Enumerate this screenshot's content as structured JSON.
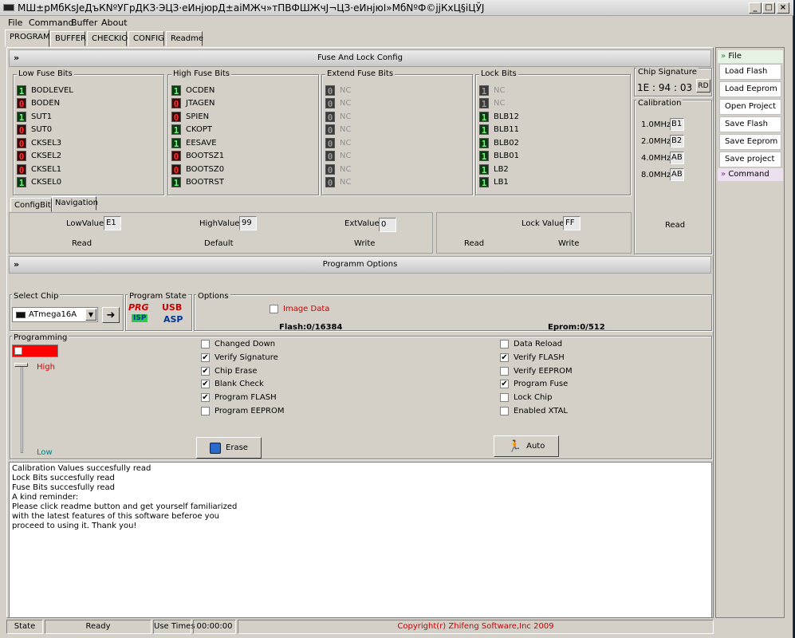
{
  "window": {
    "title": "МШ±рМбКsЈеДъКNºУГрДКЗ·ЭЦЗ·еИнјюрД±аіМЖч»тПВФШЖчЈ¬ЦЗ·еИнјюІ»МбNºФ©jjКхЦ§iЦЎЈ",
    "buttons": [
      "_",
      "□",
      "×"
    ]
  },
  "menu": [
    "File",
    "Command",
    "Buffer",
    "About"
  ],
  "tabs": [
    "PROGRAM",
    "BUFFER",
    "CHECKIO",
    "CONFIG",
    "Readme"
  ],
  "fuse_section": {
    "header": "Fuse And Lock Config",
    "low": {
      "title": "Low Fuse Bits",
      "bits": [
        {
          "v": "1",
          "s": "on",
          "n": "BODLEVEL"
        },
        {
          "v": "0",
          "s": "off",
          "n": "BODEN"
        },
        {
          "v": "1",
          "s": "on",
          "n": "SUT1"
        },
        {
          "v": "0",
          "s": "off",
          "n": "SUT0"
        },
        {
          "v": "0",
          "s": "off",
          "n": "CKSEL3"
        },
        {
          "v": "0",
          "s": "off",
          "n": "CKSEL2"
        },
        {
          "v": "0",
          "s": "off",
          "n": "CKSEL1"
        },
        {
          "v": "1",
          "s": "on",
          "n": "CKSEL0"
        }
      ]
    },
    "high": {
      "title": "High Fuse Bits",
      "bits": [
        {
          "v": "1",
          "s": "on",
          "n": "OCDEN"
        },
        {
          "v": "0",
          "s": "off",
          "n": "JTAGEN"
        },
        {
          "v": "0",
          "s": "off",
          "n": "SPIEN"
        },
        {
          "v": "1",
          "s": "on",
          "n": "CKOPT"
        },
        {
          "v": "1",
          "s": "on",
          "n": "EESAVE"
        },
        {
          "v": "0",
          "s": "off",
          "n": "BOOTSZ1"
        },
        {
          "v": "0",
          "s": "off",
          "n": "BOOTSZ0"
        },
        {
          "v": "1",
          "s": "on",
          "n": "BOOTRST"
        }
      ]
    },
    "extend": {
      "title": "Extend Fuse Bits",
      "bits": [
        {
          "v": "0",
          "s": "na",
          "n": "NC"
        },
        {
          "v": "0",
          "s": "na",
          "n": "NC"
        },
        {
          "v": "0",
          "s": "na",
          "n": "NC"
        },
        {
          "v": "0",
          "s": "na",
          "n": "NC"
        },
        {
          "v": "0",
          "s": "na",
          "n": "NC"
        },
        {
          "v": "0",
          "s": "na",
          "n": "NC"
        },
        {
          "v": "0",
          "s": "na",
          "n": "NC"
        },
        {
          "v": "0",
          "s": "na",
          "n": "NC"
        }
      ]
    },
    "lock": {
      "title": "Lock Bits",
      "bits": [
        {
          "v": "1",
          "s": "na",
          "n": "NC"
        },
        {
          "v": "1",
          "s": "na",
          "n": "NC"
        },
        {
          "v": "1",
          "s": "on",
          "n": "BLB12"
        },
        {
          "v": "1",
          "s": "on",
          "n": "BLB11"
        },
        {
          "v": "1",
          "s": "on",
          "n": "BLB02"
        },
        {
          "v": "1",
          "s": "on",
          "n": "BLB01"
        },
        {
          "v": "1",
          "s": "on",
          "n": "LB2"
        },
        {
          "v": "1",
          "s": "on",
          "n": "LB1"
        }
      ]
    },
    "subtabs": [
      "ConfigBit",
      "Navigation"
    ],
    "low_value_label": "LowValue",
    "low_value": "E1",
    "high_value_label": "HighValue",
    "high_value": "99",
    "ext_value_label": "ExtValue",
    "ext_value": "0",
    "lock_value_label": "Lock Value",
    "lock_value": "FF",
    "read": "Read",
    "default": "Default",
    "write": "Write",
    "lock_read": "Read",
    "lock_write": "Write"
  },
  "chip_signature": {
    "title": "Chip Signature",
    "value": "1E : 94 : 03",
    "rd": "RD"
  },
  "calibration": {
    "title": "Calibration",
    "rows": [
      {
        "f": "1.0MHz",
        "v": "B1"
      },
      {
        "f": "2.0MHz",
        "v": "B2"
      },
      {
        "f": "4.0MHz",
        "v": "AB"
      },
      {
        "f": "8.0MHz",
        "v": "AB"
      }
    ],
    "read": "Read"
  },
  "prog_options": {
    "header": "Programm Options",
    "select_chip": {
      "title": "Select Chip",
      "value": "ATmega16A"
    },
    "program_state": {
      "title": "Program State",
      "prg": "PRG",
      "isp": "ISP",
      "usb": "USB",
      "asp": "ASP"
    },
    "options": {
      "title": "Options",
      "image_data": "Image Data",
      "flash": "Flash:0/16384",
      "eprom": "Eprom:0/512"
    },
    "programming_title": "Programming",
    "high": "High",
    "low": "Low",
    "checks_mid": [
      {
        "l": "Changed Down",
        "c": false
      },
      {
        "l": "Verify Signature",
        "c": true
      },
      {
        "l": "Chip Erase",
        "c": true
      },
      {
        "l": "Blank Check",
        "c": true
      },
      {
        "l": "Program FLASH",
        "c": true
      },
      {
        "l": "Program EEPROM",
        "c": false
      }
    ],
    "checks_right": [
      {
        "l": "Data Reload",
        "c": false
      },
      {
        "l": "Verify FLASH",
        "c": true
      },
      {
        "l": "Verify EEPROM",
        "c": false
      },
      {
        "l": "Program Fuse",
        "c": true
      },
      {
        "l": "Lock Chip",
        "c": false
      },
      {
        "l": "Enabled XTAL",
        "c": false
      }
    ],
    "erase": "Erase",
    "auto": "Auto"
  },
  "log": "Calibration Values succesfully read\nLock Bits succesfully read\nFuse Bits succesfully read\nA kind reminder:\nPlease click readme button and get yourself familiarized\nwith the latest features of this software beferoe you\nproceed to using it. Thank you!",
  "status": {
    "state_label": "State",
    "state": "Ready",
    "use_times_label": "Use Times",
    "use_times": "00:00:00",
    "copyright": "Copyright(r) Zhifeng Software,Inc 2009"
  },
  "side": {
    "file_header": "File",
    "buttons": [
      "Load Flash",
      "Load Eeprom",
      "Open Project",
      "Save Flash",
      "Save Eeprom",
      "Save project"
    ],
    "command_header": "Command"
  },
  "colors": {
    "red_bar": "#ff0000",
    "copyright": "#cc0000",
    "image_data": "#cc0000",
    "high": "#cc0000",
    "low": "#008080"
  }
}
